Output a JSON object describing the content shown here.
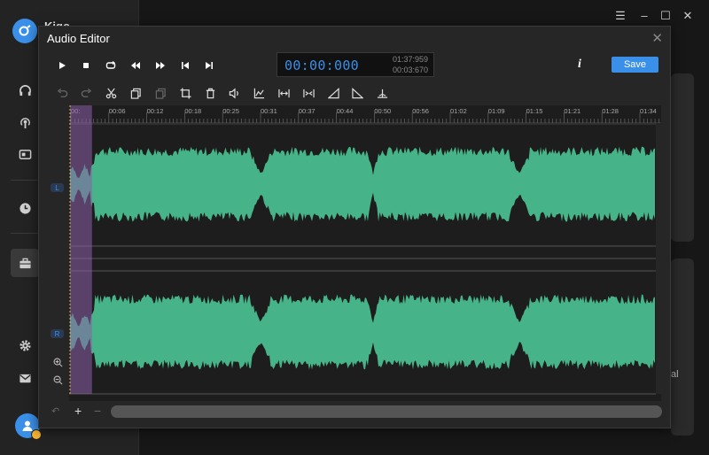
{
  "app": {
    "name": "Kigo",
    "logo_icon": "app-logo-icon"
  },
  "sidebar": {
    "items": [
      {
        "name": "headphones",
        "icon": "🎧"
      },
      {
        "name": "podcast",
        "icon": "◉"
      },
      {
        "name": "radio",
        "icon": "▤"
      },
      {
        "name": "history",
        "icon": "◷"
      },
      {
        "name": "toolbox",
        "icon": "▣"
      },
      {
        "name": "settings",
        "icon": "⚙"
      },
      {
        "name": "mail",
        "icon": "✉"
      }
    ]
  },
  "window_controls": {
    "menu": "☰",
    "minimize": "–",
    "maximize": "☐",
    "close": "✕"
  },
  "background_text": "al",
  "dialog": {
    "title": "Audio Editor",
    "close": "✕",
    "transport": {
      "play": "▶",
      "stop": "■",
      "loop": "↻",
      "rewind": "◀◀",
      "forward": "▶▶",
      "prev": "|◀",
      "next": "▶|"
    },
    "time": {
      "current": "00:00:000",
      "total": "01:37:959",
      "selection": "00:03:670"
    },
    "info": "i",
    "save_label": "Save"
  },
  "ruler_ticks": [
    "00:",
    "00:06",
    "00:12",
    "00:18",
    "00:25",
    "00:31",
    "00:37",
    "00:44",
    "00:50",
    "00:56",
    "01:02",
    "01:09",
    "01:15",
    "01:21",
    "01:28",
    "01:34"
  ],
  "channels": {
    "left": "L",
    "right": "R"
  },
  "selection": {
    "start": 0,
    "end": 3.67
  },
  "duration_seconds": 97.96,
  "colors": {
    "accent": "#3a8fe8",
    "wave": "#46b488",
    "selection": "#8a5fa8"
  },
  "bottom": {
    "undo": "↶",
    "add": "+",
    "remove": "−"
  }
}
